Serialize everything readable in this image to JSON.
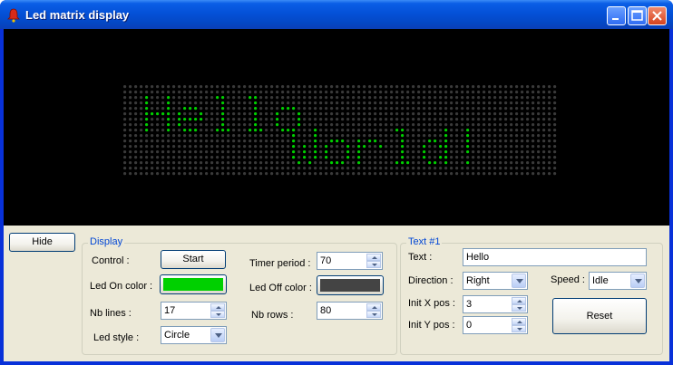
{
  "window": {
    "title": "Led matrix display"
  },
  "colors": {
    "led_on": "#00d000",
    "led_off": "#444444",
    "led_dim": "#3a3a3a",
    "led_bg": "#000000"
  },
  "led_matrix": {
    "columns": 80,
    "rows": 17
  },
  "main": {
    "hide_label": "Hide"
  },
  "display": {
    "title": "Display",
    "control_label": "Control :",
    "start_label": "Start",
    "led_on_color_label": "Led On color :",
    "led_off_color_label": "Led Off color :",
    "nb_lines_label": "Nb lines :",
    "nb_lines_value": "17",
    "led_style_label": "Led style :",
    "led_style_value": "Circle",
    "timer_period_label": "Timer period :",
    "timer_period_value": "70",
    "nb_rows_label": "Nb rows :",
    "nb_rows_value": "80"
  },
  "text1": {
    "title": "Text #1",
    "text_label": "Text :",
    "text_value": "Hello",
    "direction_label": "Direction :",
    "direction_value": "Right",
    "speed_label": "Speed :",
    "speed_value": "Idle",
    "init_x_label": "Init X pos :",
    "init_x_value": "3",
    "init_y_label": "Init Y pos :",
    "init_y_value": "0",
    "reset_label": "Reset"
  }
}
